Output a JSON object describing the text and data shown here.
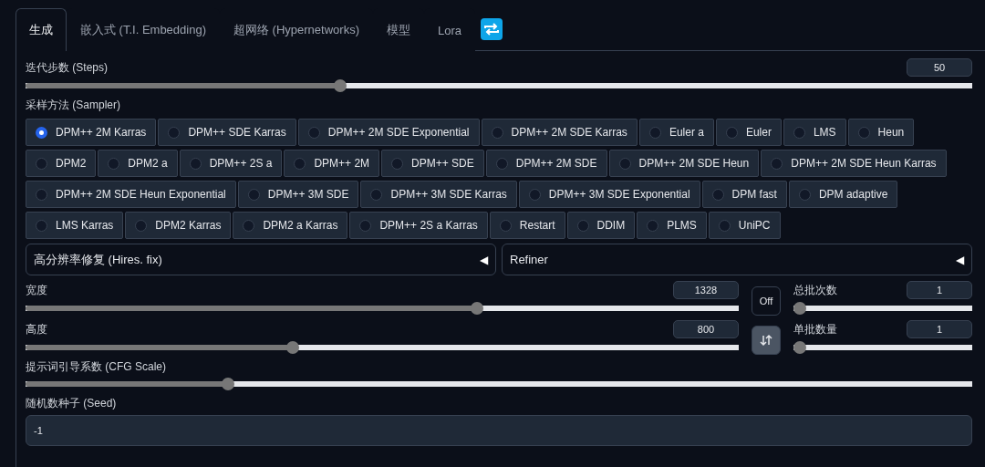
{
  "tabs": [
    {
      "label": "生成",
      "selected": true
    },
    {
      "label": "嵌入式 (T.I. Embedding)",
      "selected": false
    },
    {
      "label": "超网络 (Hypernetworks)",
      "selected": false
    },
    {
      "label": "模型",
      "selected": false
    },
    {
      "label": "Lora",
      "selected": false
    }
  ],
  "steps": {
    "label": "迭代步数 (Steps)",
    "value": "50",
    "level": 0.33
  },
  "sampler": {
    "label": "采样方法 (Sampler)",
    "options": [
      {
        "label": "DPM++ 2M Karras",
        "selected": true
      },
      {
        "label": "DPM++ SDE Karras",
        "selected": false
      },
      {
        "label": "DPM++ 2M SDE Exponential",
        "selected": false
      },
      {
        "label": "DPM++ 2M SDE Karras",
        "selected": false
      },
      {
        "label": "Euler a",
        "selected": false
      },
      {
        "label": "Euler",
        "selected": false
      },
      {
        "label": "LMS",
        "selected": false
      },
      {
        "label": "Heun",
        "selected": false
      },
      {
        "label": "DPM2",
        "selected": false
      },
      {
        "label": "DPM2 a",
        "selected": false
      },
      {
        "label": "DPM++ 2S a",
        "selected": false
      },
      {
        "label": "DPM++ 2M",
        "selected": false
      },
      {
        "label": "DPM++ SDE",
        "selected": false
      },
      {
        "label": "DPM++ 2M SDE",
        "selected": false
      },
      {
        "label": "DPM++ 2M SDE Heun",
        "selected": false
      },
      {
        "label": "DPM++ 2M SDE Heun Karras",
        "selected": false
      },
      {
        "label": "DPM++ 2M SDE Heun Exponential",
        "selected": false
      },
      {
        "label": "DPM++ 3M SDE",
        "selected": false
      },
      {
        "label": "DPM++ 3M SDE Karras",
        "selected": false
      },
      {
        "label": "DPM++ 3M SDE Exponential",
        "selected": false
      },
      {
        "label": "DPM fast",
        "selected": false
      },
      {
        "label": "DPM adaptive",
        "selected": false
      },
      {
        "label": "LMS Karras",
        "selected": false
      },
      {
        "label": "DPM2 Karras",
        "selected": false
      },
      {
        "label": "DPM2 a Karras",
        "selected": false
      },
      {
        "label": "DPM++ 2S a Karras",
        "selected": false
      },
      {
        "label": "Restart",
        "selected": false
      },
      {
        "label": "DDIM",
        "selected": false
      },
      {
        "label": "PLMS",
        "selected": false
      },
      {
        "label": "UniPC",
        "selected": false
      }
    ]
  },
  "accordions": [
    {
      "label": "高分辨率修复 (Hires. fix)",
      "marker": "◀"
    },
    {
      "label": "Refiner",
      "marker": "◀"
    }
  ],
  "width": {
    "label": "宽度",
    "value": "1328",
    "level": 0.636
  },
  "height": {
    "label": "高度",
    "value": "800",
    "level": 0.373
  },
  "toggle_button": {
    "label": "Off"
  },
  "batch_count": {
    "label": "总批次数",
    "value": "1",
    "level": 0
  },
  "batch_size": {
    "label": "单批数量",
    "value": "1",
    "level": 0
  },
  "cfg": {
    "label": "提示词引导系数 (CFG Scale)",
    "level": 0.21
  },
  "seed": {
    "label": "随机数种子 (Seed)",
    "value": "-1"
  }
}
